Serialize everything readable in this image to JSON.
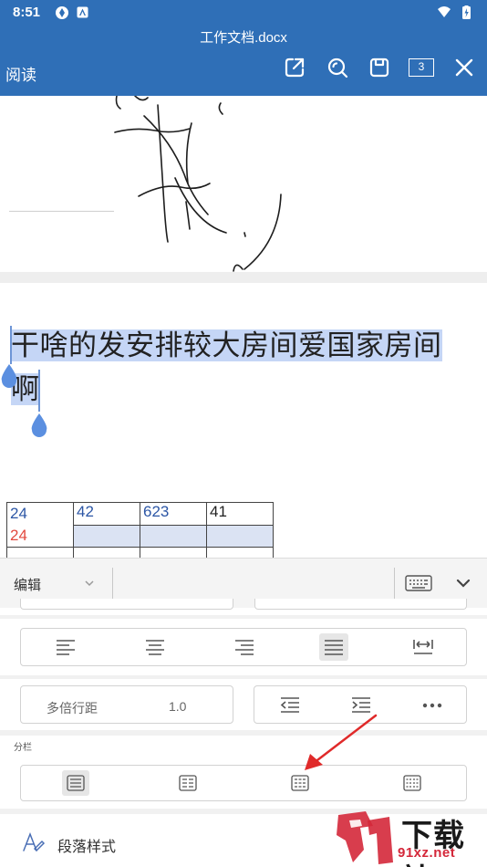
{
  "status_bar": {
    "time": "8:51"
  },
  "header": {
    "title": "工作文档.docx",
    "read_label": "阅读",
    "page_count": "3"
  },
  "document": {
    "selected_text_line1": "干啥的发安排较大房间爱国家房间",
    "selected_text_line2": "啊",
    "table": {
      "row1": [
        "24",
        "42",
        "623",
        "41"
      ],
      "row1_extra": "24"
    }
  },
  "edit_panel": {
    "mode_label": "编辑",
    "line_spacing_label": "多倍行距",
    "line_spacing_value": "1.0",
    "columns_title": "分栏",
    "paragraph_style_label": "段落样式",
    "active_alignment": "justify",
    "active_columns": "one-column"
  },
  "watermark": {
    "text_main": "下载站",
    "text_sub": "91xz.net"
  },
  "colors": {
    "brand": "#2f6fb7",
    "selection": "#c5d6f6",
    "handle": "#5b8fe0",
    "arrow": "#e02a2a"
  }
}
